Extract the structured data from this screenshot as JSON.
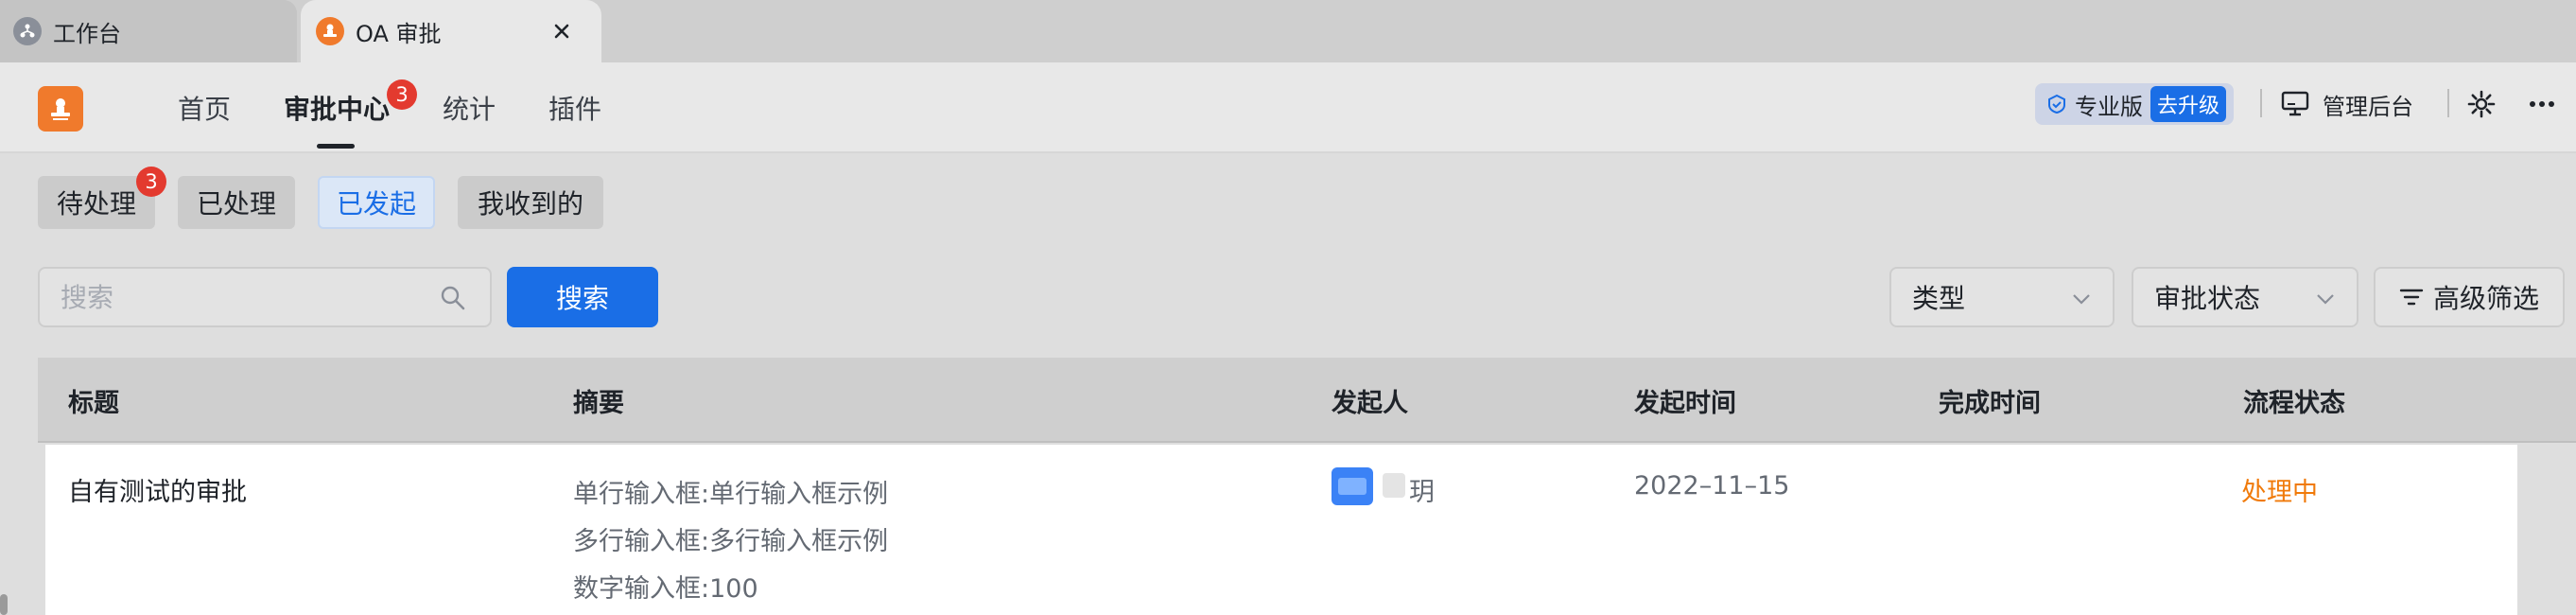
{
  "browser_tabs": [
    {
      "label": "工作台"
    },
    {
      "label": "OA 审批"
    }
  ],
  "header": {
    "nav": [
      {
        "label": "首页"
      },
      {
        "label": "审批中心",
        "badge": "3"
      },
      {
        "label": "统计"
      },
      {
        "label": "插件"
      }
    ],
    "edition_label": "专业版",
    "upgrade_label": "去升级",
    "admin_label": "管理后台"
  },
  "filters": {
    "tabs": [
      {
        "label": "待处理",
        "badge": "3"
      },
      {
        "label": "已处理"
      },
      {
        "label": "已发起",
        "selected": true
      },
      {
        "label": "我收到的"
      }
    ]
  },
  "search": {
    "placeholder": "搜索",
    "button_label": "搜索",
    "type_select": "类型",
    "status_select": "审批状态",
    "advanced_filter": "高级筛选"
  },
  "table": {
    "columns": [
      "标题",
      "摘要",
      "发起人",
      "发起时间",
      "完成时间",
      "流程状态"
    ],
    "rows": [
      {
        "title": "自有测试的审批",
        "summary": [
          "单行输入框:单行输入框示例",
          "多行输入框:多行输入框示例",
          "数字输入框:100"
        ],
        "initiator": "玥",
        "start_time": "2022–11–15",
        "finish_time": "",
        "status": "处理中"
      }
    ]
  },
  "colors": {
    "accent": "#1a6ee6",
    "brand_orange": "#f07a2c",
    "badge_red": "#e33a2f",
    "status_processing": "#f07a0a"
  }
}
